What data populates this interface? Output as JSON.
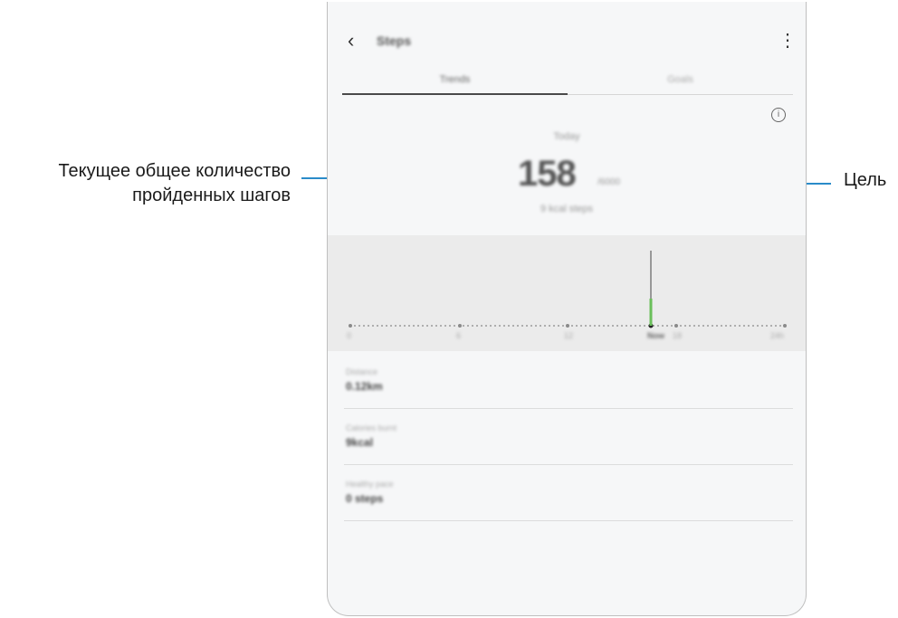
{
  "callouts": {
    "left_line1": "Текущее общее количество",
    "left_line2": "пройденных шагов",
    "right": "Цель"
  },
  "app": {
    "title": "Steps",
    "back_icon": "chevron-left-icon",
    "menu_icon": "more-vertical-icon"
  },
  "tabs": [
    {
      "label": "Trends"
    },
    {
      "label": "Goals"
    }
  ],
  "summary": {
    "today_label": "Today",
    "steps": "158",
    "goal": "/6000",
    "kcal": "9 kcal steps"
  },
  "chart_data": {
    "type": "bar",
    "x_ticks": [
      "0",
      "6",
      "12",
      "Now",
      "18",
      "24h"
    ],
    "values": [
      {
        "x": "Now",
        "y": 158
      }
    ],
    "bar_color": "#6abf5a"
  },
  "stats": [
    {
      "label": "Distance",
      "value": "0.12km"
    },
    {
      "label": "Calories burnt",
      "value": "9kcal"
    },
    {
      "label": "Healthy pace",
      "value": "0 steps"
    }
  ]
}
